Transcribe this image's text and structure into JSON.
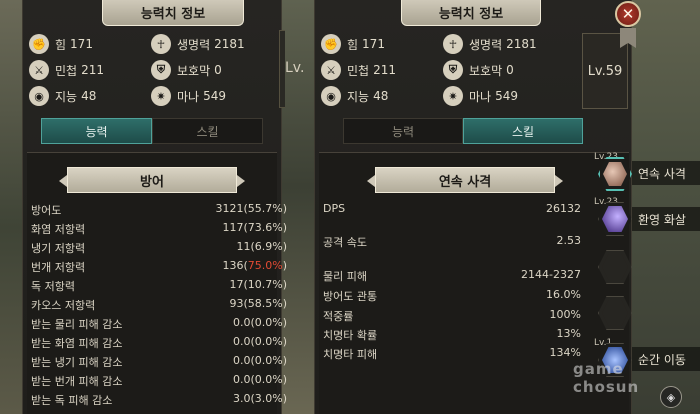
{
  "window_title": "능력치 정보",
  "stats": {
    "strength": {
      "label": "힘",
      "value": "171",
      "icon": "fist-icon"
    },
    "health": {
      "label": "생명력",
      "value": "2181",
      "icon": "ankh-icon"
    },
    "agility": {
      "label": "민첩",
      "value": "211",
      "icon": "claw-icon"
    },
    "shield": {
      "label": "보호막",
      "value": "0",
      "icon": "shield-icon"
    },
    "intelligence": {
      "label": "지능",
      "value": "48",
      "icon": "eye-icon"
    },
    "mana": {
      "label": "마나",
      "value": "549",
      "icon": "sun-icon"
    }
  },
  "level_text_cut": "Lv.",
  "level_text": "Lv.59",
  "tabs": {
    "ability": "능력",
    "skill": "스킬"
  },
  "defense": {
    "title": "방어",
    "rows": [
      {
        "label": "방어도",
        "value": "3121(55.7%)"
      },
      {
        "label": "화염 저항력",
        "value": "117(73.6%)"
      },
      {
        "label": "냉기 저항력",
        "value": "11(6.9%)"
      },
      {
        "label": "번개 저항력",
        "value": "136(",
        "value_red": "75.0%",
        "value_tail": ")"
      },
      {
        "label": "독 저항력",
        "value": "17(10.7%)"
      },
      {
        "label": "카오스 저항력",
        "value": "93(58.5%)"
      },
      {
        "label": "받는 물리 피해 감소",
        "value": "0.0(0.0%)"
      },
      {
        "label": "받는 화염 피해 감소",
        "value": "0.0(0.0%)"
      },
      {
        "label": "받는 냉기 피해 감소",
        "value": "0.0(0.0%)"
      },
      {
        "label": "받는 번개 피해 감소",
        "value": "0.0(0.0%)"
      },
      {
        "label": "받는 독 피해 감소",
        "value": "3.0(3.0%)"
      }
    ]
  },
  "skill_detail": {
    "title": "연속 사격",
    "rows": [
      {
        "label": "DPS",
        "value": "26132"
      },
      {
        "label": "공격 속도",
        "value": "2.53"
      },
      {
        "label": "물리 피해",
        "value": "2144-2327"
      },
      {
        "label": "방어도 관통",
        "value": "16.0%"
      },
      {
        "label": "적중률",
        "value": "100%"
      },
      {
        "label": "치명타 확률",
        "value": "13%"
      },
      {
        "label": "치명타 피해",
        "value": "134%"
      }
    ]
  },
  "skill_slots": [
    {
      "level": "Lv.23",
      "name": "연속 사격",
      "icon": "arrow-burst-icon",
      "color": "#c4a89a"
    },
    {
      "level": "Lv.23",
      "name": "환영 화살",
      "icon": "spectral-arrow-icon",
      "color": "#7e5ad1"
    },
    {
      "level": "",
      "name": "",
      "icon": "empty-slot-icon"
    },
    {
      "level": "",
      "name": "",
      "icon": "empty-slot-icon"
    },
    {
      "level": "Lv.1",
      "name": "순간 이동",
      "icon": "blink-icon",
      "color": "#4d78e0"
    }
  ],
  "watermark": {
    "line1": "game",
    "line2": "chosun"
  },
  "colors": {
    "accent_teal": "#2e6e69",
    "warning_red": "#e14a34"
  }
}
